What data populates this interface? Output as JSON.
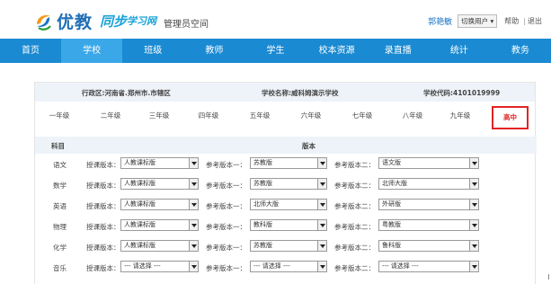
{
  "brand": {
    "name": "优教",
    "sub_a": "同步",
    "sub_b": "学习网",
    "space": "管理员空间"
  },
  "user": {
    "name": "郭艳敏",
    "switch_label": "切换用户",
    "help": "帮助",
    "separator": "|",
    "logout": "退出"
  },
  "nav": {
    "items": [
      "首页",
      "学校",
      "班级",
      "教师",
      "学生",
      "校本资源",
      "录直播",
      "统计",
      "教务"
    ],
    "active_index": 1
  },
  "info": {
    "district": "行政区:河南省.郑州市.市辖区",
    "school": "学校名称:威科姆演示学校",
    "code": "学校代码:4101019999"
  },
  "grades": {
    "items": [
      "一年级",
      "二年级",
      "三年级",
      "四年级",
      "五年级",
      "六年级",
      "七年级",
      "八年级",
      "九年级",
      "高中"
    ],
    "selected_index": 9
  },
  "table": {
    "header_subject": "科目",
    "header_version": "版本",
    "label_teach": "授课版本：",
    "label_ref1": "参考版本一：",
    "label_ref2": "参考版本二：",
    "rows": [
      {
        "subject": "语文",
        "teach": "人教课标版",
        "ref1": "苏教版",
        "ref2": "语文版"
      },
      {
        "subject": "数学",
        "teach": "人教课标版",
        "ref1": "苏教版",
        "ref2": "北师大版"
      },
      {
        "subject": "英语",
        "teach": "人教课标版",
        "ref1": "北师大版",
        "ref2": "外研版"
      },
      {
        "subject": "物理",
        "teach": "人教课标版",
        "ref1": "教科版",
        "ref2": "粤教版"
      },
      {
        "subject": "化学",
        "teach": "人教课标版",
        "ref1": "苏教版",
        "ref2": "鲁科版"
      },
      {
        "subject": "音乐",
        "teach": "--- 请选择 ---",
        "ref1": "--- 请选择 ---",
        "ref2": "--- 请选择 ---"
      }
    ]
  }
}
